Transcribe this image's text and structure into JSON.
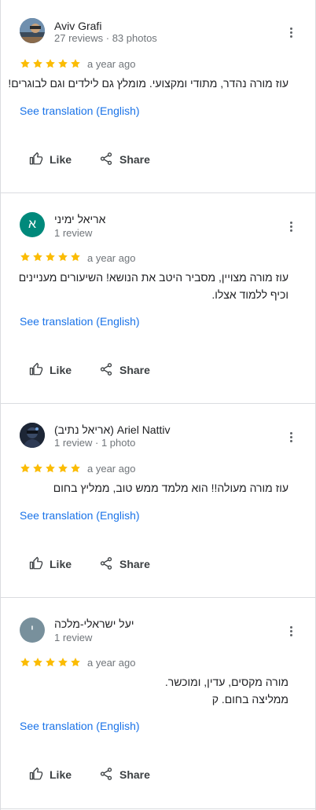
{
  "reviews": [
    {
      "name": "Aviv Grafi",
      "meta": "27 reviews · 83 photos",
      "avatar_letter": "",
      "avatar_kind": "photo-landscape",
      "rating": 5,
      "date": "a year ago",
      "text_lines": [
        "עוז מורה נהדר, מתודי ומקצועי. מומלץ גם לילדים וגם לבוגרים!"
      ],
      "translate_label": "See translation (English)",
      "like_label": "Like",
      "share_label": "Share"
    },
    {
      "name": "אריאל ימיני",
      "meta": "1 review",
      "avatar_letter": "א",
      "avatar_color": "#00897b",
      "avatar_kind": "letter",
      "rating": 5,
      "date": "a year ago",
      "text_lines": [
        "עוז מורה מצויין, מסביר היטב את הנושא! השיעורים מעניינים",
        "וכיף ללמוד אצלו."
      ],
      "translate_label": "See translation (English)",
      "like_label": "Like",
      "share_label": "Share"
    },
    {
      "name": "(אריאל נתיב) Ariel Nattiv",
      "meta": "1 review · 1 photo",
      "avatar_letter": "",
      "avatar_kind": "photo-dark",
      "rating": 5,
      "date": "a year ago",
      "text_lines": [
        "עוז מורה מעולה!! הוא מלמד ממש טוב, ממליץ בחום"
      ],
      "translate_label": "See translation (English)",
      "like_label": "Like",
      "share_label": "Share"
    },
    {
      "name": "יעל ישראלי-מלכה",
      "meta": "1 review",
      "avatar_letter": "י",
      "avatar_color": "#78909c",
      "avatar_kind": "letter",
      "rating": 5,
      "date": "a year ago",
      "text_lines": [
        "מורה מקסים, עדין, ומוכשר.",
        "ממליצה בחום. ק"
      ],
      "translate_label": "See translation (English)",
      "like_label": "Like",
      "share_label": "Share"
    }
  ],
  "colors": {
    "star": "#fbbc04",
    "link": "#1a73e8",
    "secondary_text": "#70757a",
    "divider": "#dadce0"
  }
}
